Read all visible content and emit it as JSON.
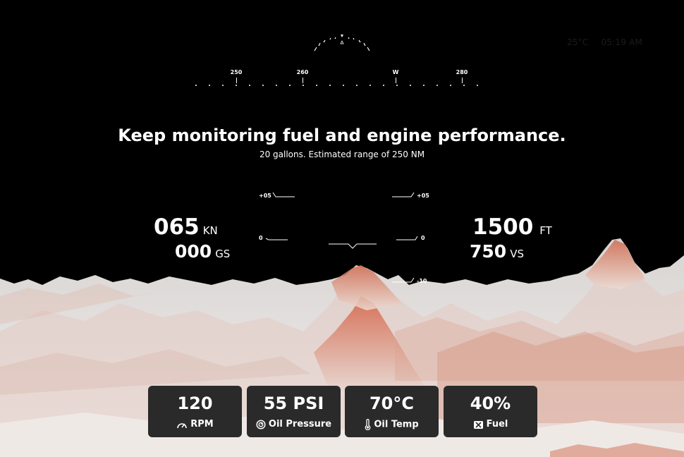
{
  "status": {
    "temperature": "25°C",
    "time": "05:19 AM"
  },
  "heading_tape": {
    "marks": [
      "250",
      "260",
      "W",
      "280"
    ]
  },
  "message": {
    "title": "Keep monitoring fuel and engine performance.",
    "subtitle": "20 gallons. Estimated range of 250 NM"
  },
  "left_readouts": {
    "airspeed": {
      "value": "065",
      "unit": "KN"
    },
    "groundspeed": {
      "value": "000",
      "unit": "GS"
    }
  },
  "right_readouts": {
    "altitude": {
      "value": "1500",
      "unit": "FT"
    },
    "vertical_speed": {
      "value": "750",
      "unit": "VS"
    }
  },
  "pitch_ladder": {
    "left_upper": "+05",
    "left_zero": "0",
    "right_upper": "+05",
    "right_zero": "0",
    "right_lower": "-10"
  },
  "metrics": [
    {
      "value": "120",
      "label": "RPM",
      "icon": "gauge-icon"
    },
    {
      "value": "55 PSI",
      "label": "Oil Pressure",
      "icon": "oil-pressure-icon"
    },
    {
      "value": "70°C",
      "label": "Oil Temp",
      "icon": "thermometer-icon"
    },
    {
      "value": "40%",
      "label": "Fuel",
      "icon": "fuel-icon"
    }
  ],
  "colors": {
    "background": "#000000",
    "terrain_light": "#e7e4e2",
    "terrain_accent": "#d4745a",
    "card_background": "#2a2a2a"
  }
}
